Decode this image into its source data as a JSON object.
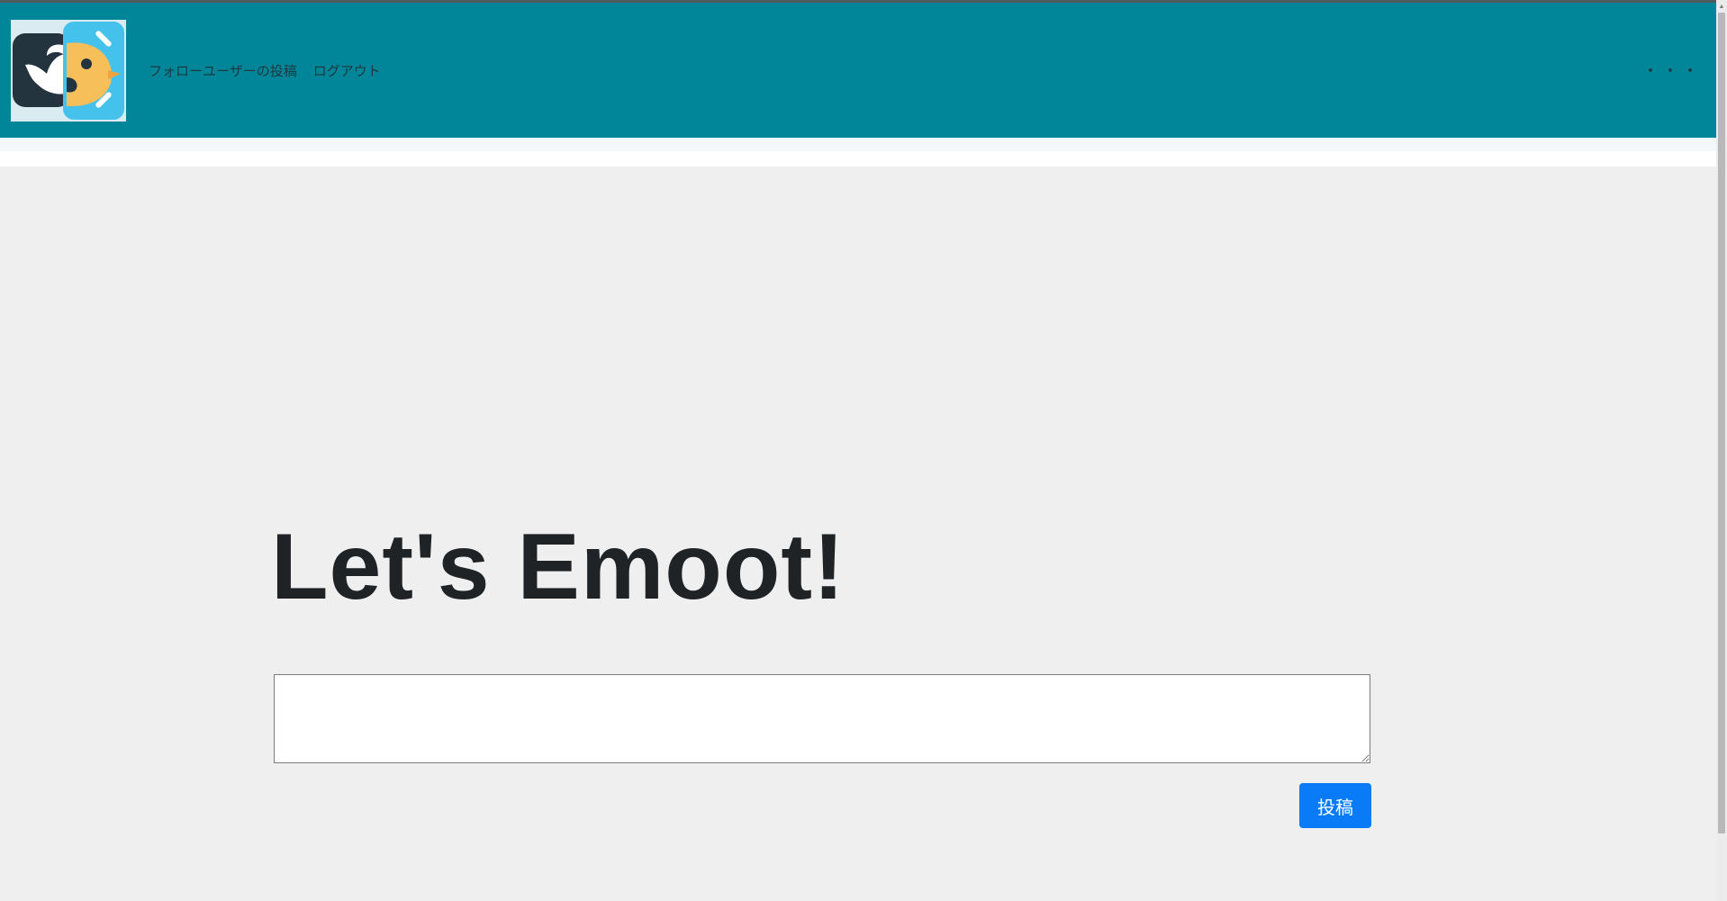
{
  "navbar": {
    "logo_icon": "emoot-bird-logo-icon",
    "links": [
      {
        "label": "フォローユーザーの投稿"
      },
      {
        "label": "ログアウト"
      }
    ],
    "more_label": "・・・",
    "background": "#008698"
  },
  "main": {
    "heading": "Let's Emoot!",
    "textarea": {
      "value": "",
      "placeholder": ""
    },
    "submit_label": "投稿",
    "submit_color": "#0a7bf7"
  },
  "scrollbar": {
    "up_arrow_icon": "scroll-up-arrow-icon"
  }
}
